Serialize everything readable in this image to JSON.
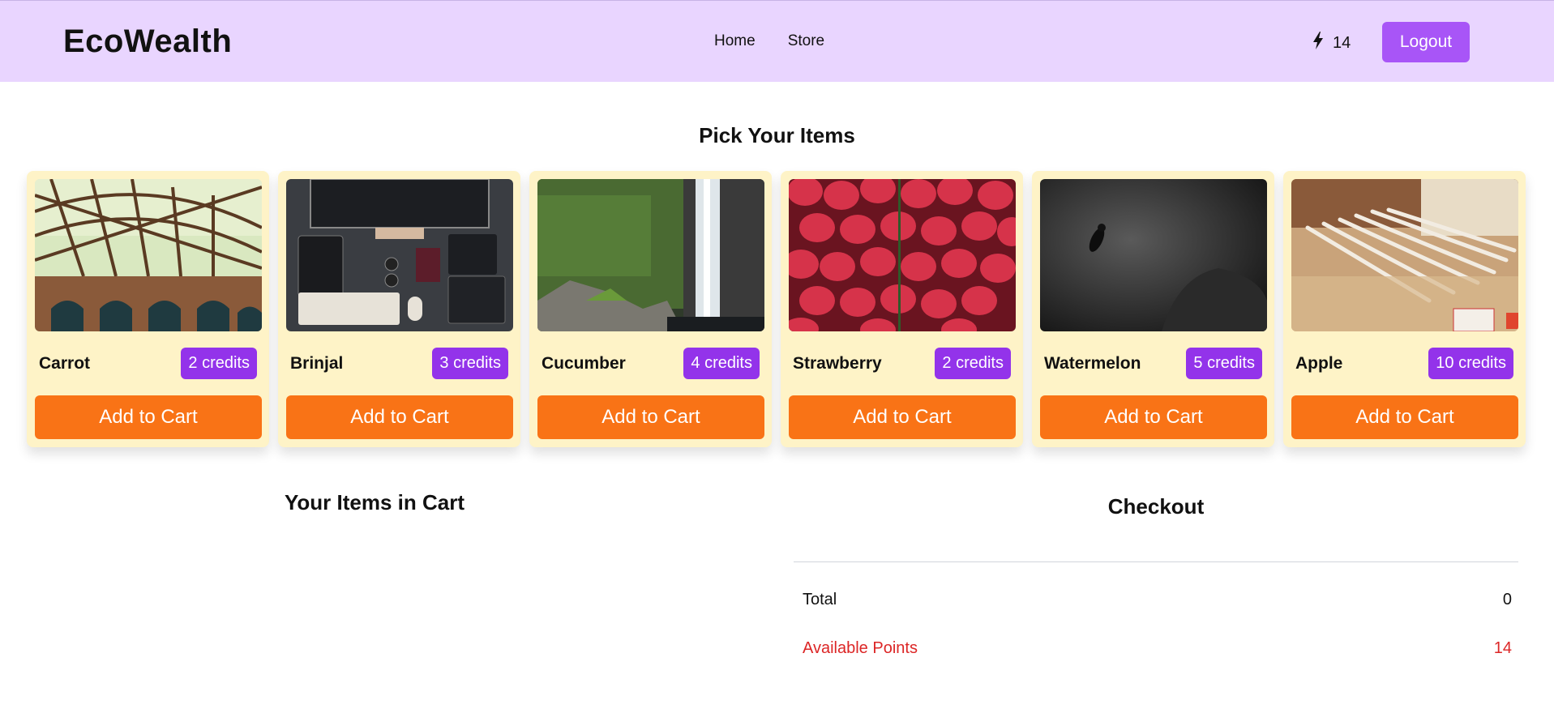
{
  "header": {
    "brand": "EcoWealth",
    "nav": [
      "Home",
      "Store"
    ],
    "points": "14",
    "points_icon": "lightning-bolt-icon",
    "logout_label": "Logout"
  },
  "store": {
    "title": "Pick Your Items",
    "items": [
      {
        "name": "Carrot",
        "credits": "2 credits",
        "button": "Add to Cart",
        "image": "bridge-photo"
      },
      {
        "name": "Brinjal",
        "credits": "3 credits",
        "button": "Add to Cart",
        "image": "desk-setup-photo"
      },
      {
        "name": "Cucumber",
        "credits": "4 credits",
        "button": "Add to Cart",
        "image": "waterfall-photo"
      },
      {
        "name": "Strawberry",
        "credits": "2 credits",
        "button": "Add to Cart",
        "image": "strawberries-photo"
      },
      {
        "name": "Watermelon",
        "credits": "5 credits",
        "button": "Add to Cart",
        "image": "diver-photo"
      },
      {
        "name": "Apple",
        "credits": "10 credits",
        "button": "Add to Cart",
        "image": "pencils-photo"
      }
    ]
  },
  "cart": {
    "title": "Your Items in Cart"
  },
  "checkout": {
    "title": "Checkout",
    "total_label": "Total",
    "total_value": "0",
    "available_label": "Available Points",
    "available_value": "14"
  },
  "colors": {
    "header_bg": "#e9d5ff",
    "card_bg": "#fef3c7",
    "badge": "#9333ea",
    "button": "#f97316",
    "logout": "#a855f7",
    "warning_text": "#dc2626"
  }
}
